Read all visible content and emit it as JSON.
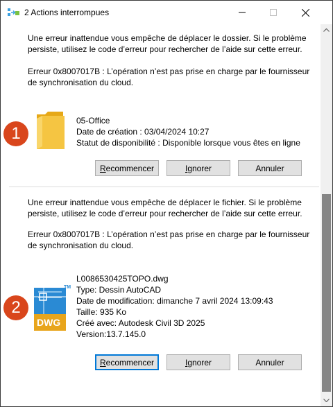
{
  "window": {
    "title": "2 Actions interrompues"
  },
  "errors": [
    {
      "message_lines": [
        "Une erreur inattendue vous empêche de déplacer le dossier. Si le problème",
        "persiste, utilisez le code d’erreur pour rechercher de l’aide sur cette erreur."
      ],
      "code_lines": [
        "Erreur 0x8007017B : L’opération n’est pas prise en charge par le fournisseur",
        "de synchronisation du cloud."
      ],
      "item_lines": [
        "05-Office",
        "Date de création : 03/04/2024 10:27",
        "Statut de disponibilité : Disponible lorsque vous êtes en ligne"
      ],
      "icon": "folder-icon",
      "badge": "1",
      "buttons": {
        "retry": {
          "lead": "",
          "ul": "R",
          "rest": "ecommencer"
        },
        "skip": {
          "lead": "",
          "ul": "I",
          "rest": "gnorer"
        },
        "cancel": "Annuler"
      }
    },
    {
      "message_lines": [
        "Une erreur inattendue vous empêche de déplacer le fichier. Si le problème",
        "persiste, utilisez le code d’erreur pour rechercher de l’aide sur cette erreur."
      ],
      "code_lines": [
        "Erreur 0x8007017B : L’opération n’est pas prise en charge par le fournisseur",
        "de synchronisation du cloud."
      ],
      "item_lines": [
        "L0086530425TOPO.dwg",
        "Type: Dessin AutoCAD",
        "Date de modification: dimanche 7 avril 2024 13:09:43",
        "Taille: 935 Ko",
        "Créé avec: Autodesk Civil 3D 2025",
        "Version:13.7.145.0"
      ],
      "icon": "dwg-file-icon",
      "icon_label": "DWG",
      "icon_tm": "TM",
      "badge": "2",
      "buttons": {
        "retry": {
          "lead": "",
          "ul": "R",
          "rest": "ecommencer"
        },
        "skip": {
          "lead": "",
          "ul": "I",
          "rest": "gnorer"
        },
        "cancel": "Annuler"
      }
    }
  ],
  "colors": {
    "badge": "#d9461c",
    "folder": "#f5c542",
    "dwg_blue": "#2a8ad4",
    "dwg_yellow": "#e8a51c",
    "focus": "#0078d7"
  }
}
